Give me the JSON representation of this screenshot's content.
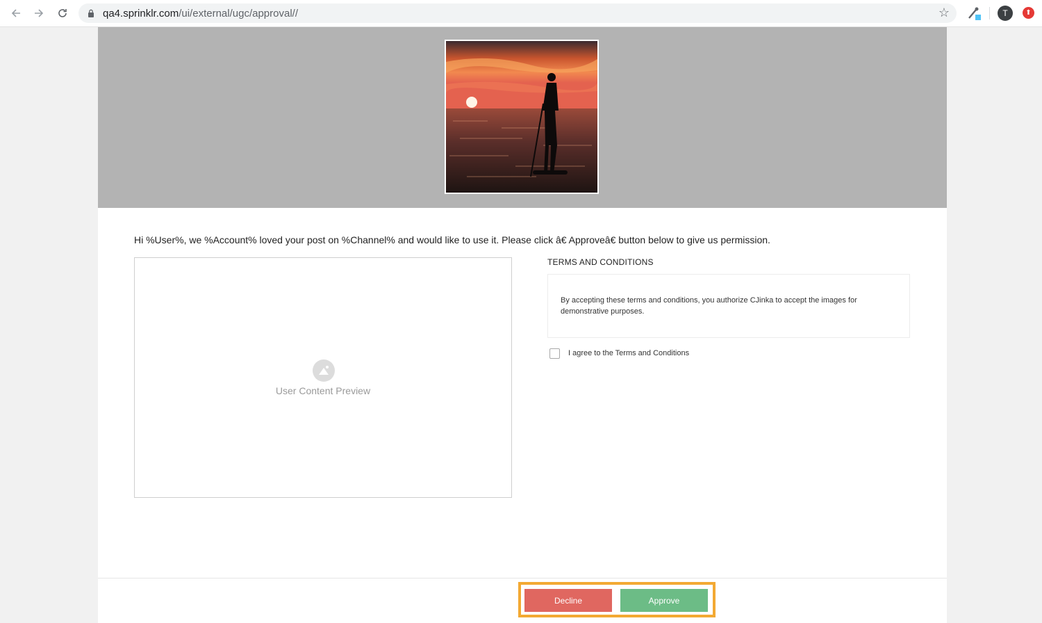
{
  "browser": {
    "url_host": "qa4.sprinklr.com",
    "url_path": "/ui/external/ugc/approval//",
    "avatar_letter": "T",
    "icons": [
      "back-arrow-icon",
      "forward-arrow-icon",
      "reload-icon",
      "lock-icon",
      "star-icon",
      "extension-icon",
      "profile-avatar",
      "extension-red-icon"
    ]
  },
  "page": {
    "intro_text": "Hi %User%, we %Account% loved your post on %Channel% and would like to use it. Please click â€  Approveâ€   button below to give us permission.",
    "preview_label": "User Content Preview",
    "terms": {
      "heading": "TERMS AND CONDITIONS",
      "body": "By accepting these terms and conditions, you authorize CJinka to accept the images for demonstrative purposes.",
      "agree_label": "I agree to the Terms and Conditions",
      "agree_checked": false
    },
    "actions": {
      "decline_label": "Decline",
      "approve_label": "Approve"
    }
  },
  "colors": {
    "banner": "#b3b3b3",
    "decline": "#e06760",
    "approve": "#6cbc86",
    "highlight": "#f3a933"
  }
}
